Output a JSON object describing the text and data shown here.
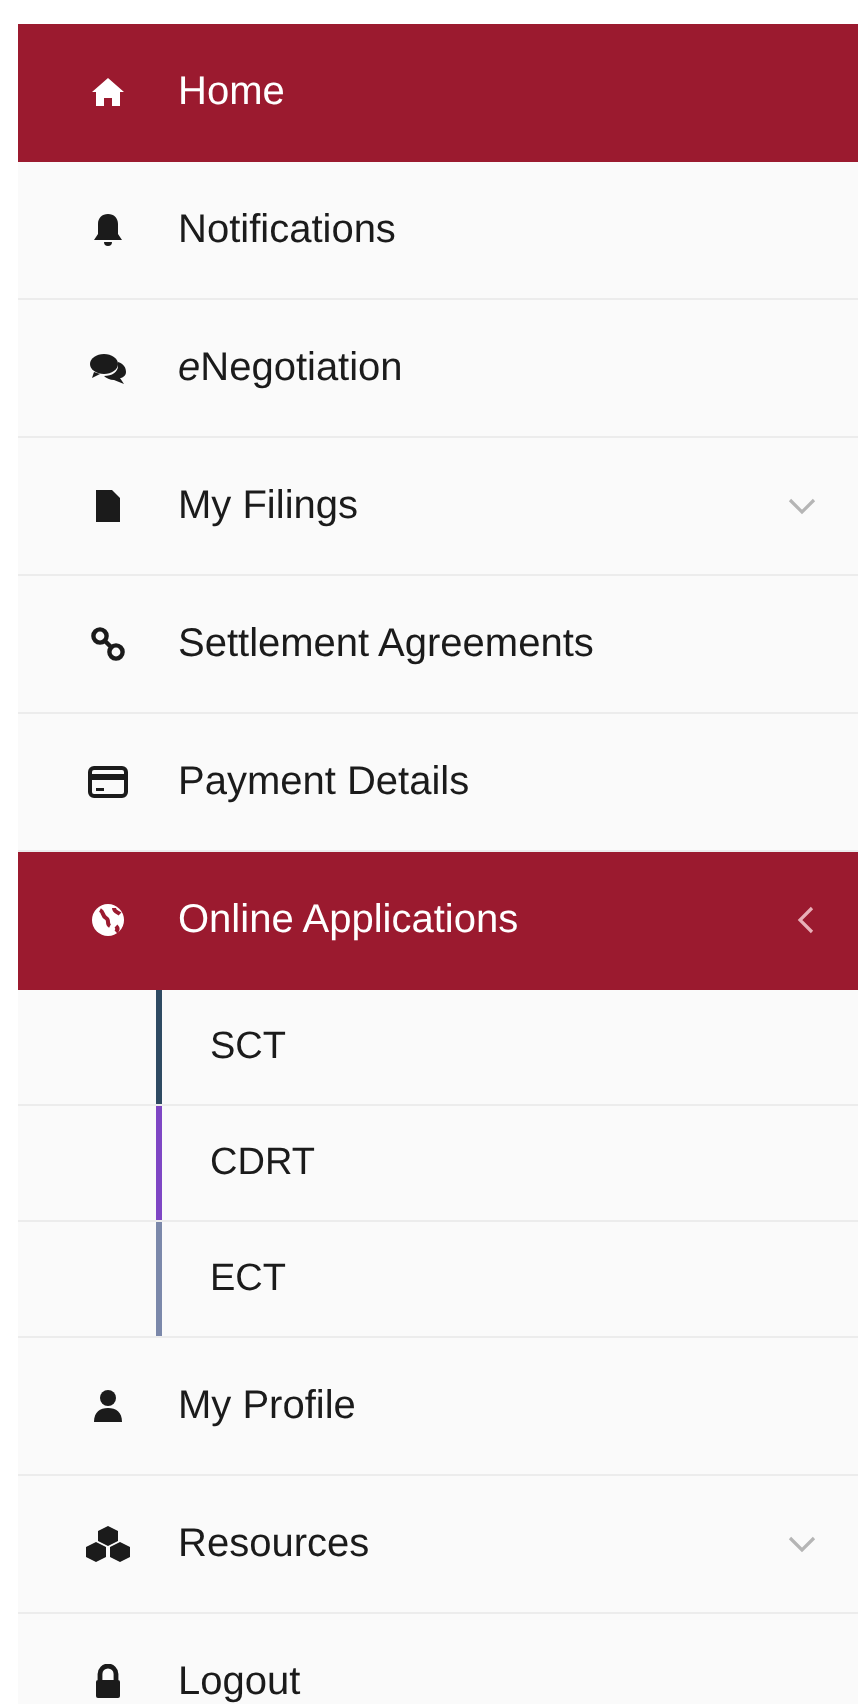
{
  "menu": {
    "items": [
      {
        "label": "Home",
        "selected": true
      },
      {
        "label": "Notifications",
        "selected": false
      },
      {
        "italic_prefix": "e",
        "label": "Negotiation",
        "selected": false
      },
      {
        "label": "My Filings",
        "selected": false,
        "expanded": false
      },
      {
        "label": "Settlement Agreements",
        "selected": false
      },
      {
        "label": "Payment Details",
        "selected": false
      },
      {
        "label": "Online Applications",
        "selected": true,
        "expanded": true,
        "children": [
          {
            "label": "SCT",
            "color": "#2e4a62"
          },
          {
            "label": "CDRT",
            "color": "#7e46c4"
          },
          {
            "label": "ECT",
            "color": "#7b88aa"
          }
        ]
      },
      {
        "label": "My Profile",
        "selected": false
      },
      {
        "label": "Resources",
        "selected": false,
        "expanded": false
      },
      {
        "label": "Logout",
        "selected": false
      }
    ]
  }
}
